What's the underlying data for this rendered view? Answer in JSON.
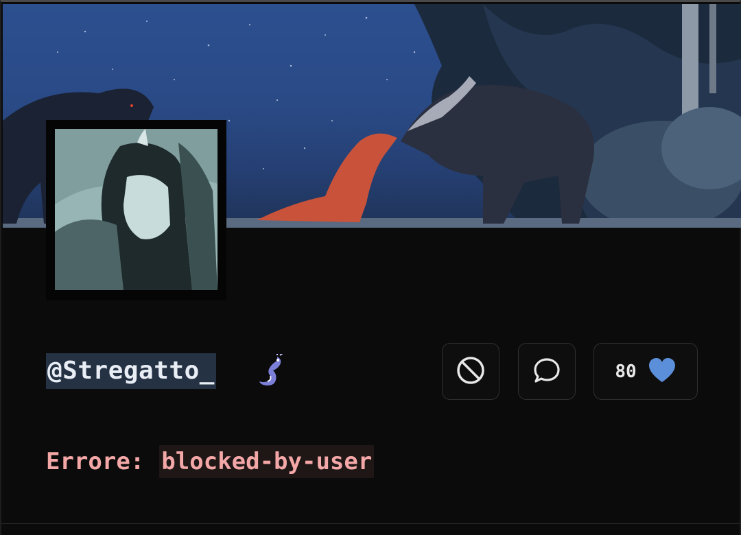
{
  "profile": {
    "username": "@Stregatto_",
    "badge_icon": "dragon-badge-icon",
    "banner_image": "night-forest-animals-banner",
    "avatar_image": "manga-girl-avatar"
  },
  "actions": {
    "block_icon": "block-icon",
    "message_icon": "message-icon",
    "likes_count": "80",
    "like_icon": "heart-icon"
  },
  "error": {
    "label": "Errore:",
    "code": "blocked-by-user"
  },
  "colors": {
    "background": "#0b0b0b",
    "username_highlight": "#253244",
    "error_text": "#f3a7a7",
    "heart": "#5b8fd9"
  }
}
